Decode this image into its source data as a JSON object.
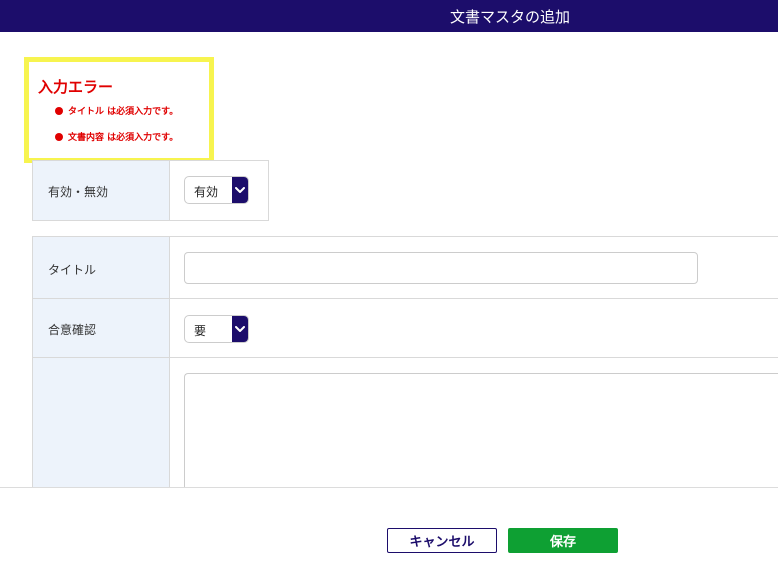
{
  "header": {
    "title": "文書マスタの追加"
  },
  "errors": {
    "title": "入力エラー",
    "items": [
      "タイトル は必須入力です。",
      "文書内容 は必須入力です。"
    ]
  },
  "form": {
    "status": {
      "label": "有効・無効",
      "value": "有効"
    },
    "title_field": {
      "label": "タイトル",
      "value": ""
    },
    "consent": {
      "label": "合意確認",
      "value": "要"
    },
    "content": {
      "label": "",
      "value": ""
    }
  },
  "footer": {
    "cancel_label": "キャンセル",
    "save_label": "保存"
  },
  "colors": {
    "header_bg": "#1c0d6b",
    "error_border": "#f7f44f",
    "error_text": "#e00000",
    "label_bg": "#edf3fb",
    "save_bg": "#0ea033"
  }
}
